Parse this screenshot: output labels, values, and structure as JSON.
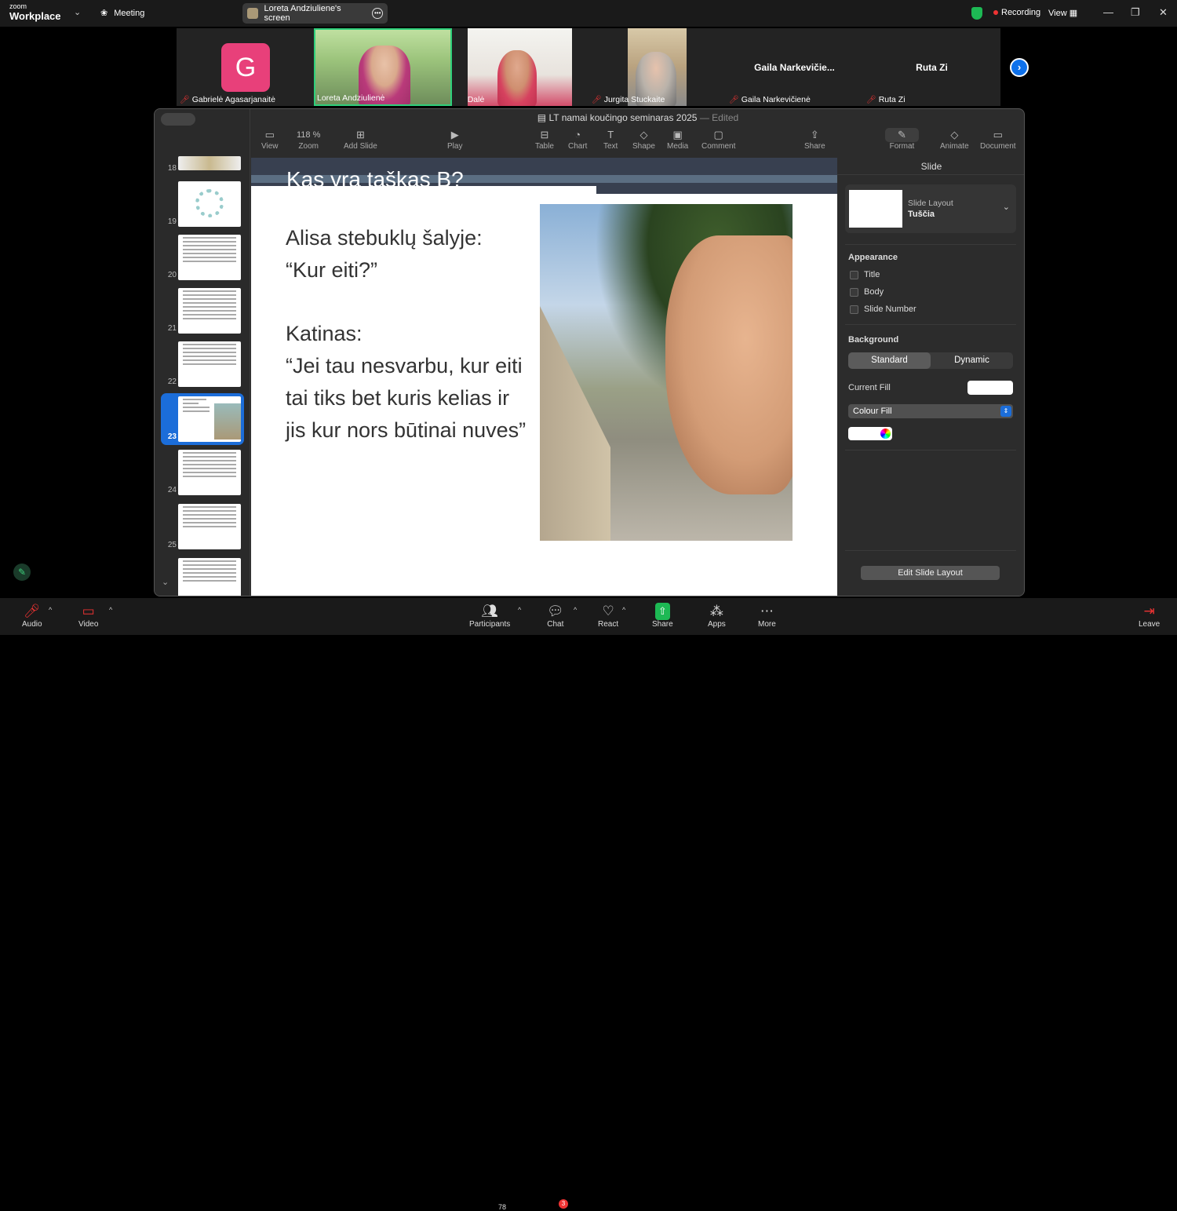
{
  "topbar": {
    "brand_small": "zoom",
    "brand_main": "Workplace",
    "meeting_label": "Meeting",
    "screen_label": "Loreta Andziuliene's screen",
    "recording_label": "Recording",
    "view_label": "View"
  },
  "participants": [
    {
      "name": "Gabrielė Agasarjanaitė",
      "initial": "G",
      "muted": true
    },
    {
      "name": "Loreta Andziulienė",
      "muted": false
    },
    {
      "name": "Dalė",
      "muted": true
    },
    {
      "name": "Jurgita Stuckaite",
      "muted": true
    },
    {
      "name": "Gaila Narkevičienė",
      "display": "Gaila  Narkevičie...",
      "muted": true
    },
    {
      "name": "Ruta Zi",
      "display": "Ruta Zi",
      "muted": true
    }
  ],
  "keynote": {
    "doc_title": "LT namai koučingo seminaras 2025",
    "doc_status": "Edited",
    "toolbar": {
      "view": "View",
      "zoom_value": "118 %",
      "zoom": "Zoom",
      "add_slide": "Add Slide",
      "play": "Play",
      "table": "Table",
      "chart": "Chart",
      "text": "Text",
      "shape": "Shape",
      "media": "Media",
      "comment": "Comment",
      "share": "Share",
      "format": "Format",
      "animate": "Animate",
      "document": "Document"
    },
    "thumb_numbers": [
      "18",
      "19",
      "20",
      "21",
      "22",
      "23",
      "24",
      "25"
    ],
    "selected_slide": "23",
    "slide": {
      "title": "Kas yra taškas B?",
      "line1": "Alisa stebuklų šalyje:",
      "line2": "“Kur eiti?”",
      "line3": "Katinas:",
      "line4": "“Jei tau nesvarbu, kur eiti",
      "line5": " tai tiks bet kuris kelias ir",
      "line6": "jis kur nors būtinai nuves”"
    },
    "inspector": {
      "header": "Slide",
      "layout_label": "Slide Layout",
      "layout_value": "Tuščia",
      "appearance": "Appearance",
      "opt_title": "Title",
      "opt_body": "Body",
      "opt_slide_number": "Slide Number",
      "background": "Background",
      "seg_standard": "Standard",
      "seg_dynamic": "Dynamic",
      "current_fill": "Current Fill",
      "fill_type": "Colour Fill",
      "edit_layout": "Edit Slide Layout"
    }
  },
  "bottombar": {
    "audio": "Audio",
    "video": "Video",
    "participants": "Participants",
    "participants_count": "78",
    "chat": "Chat",
    "chat_badge": "3",
    "react": "React",
    "share": "Share",
    "apps": "Apps",
    "more": "More",
    "leave": "Leave"
  }
}
